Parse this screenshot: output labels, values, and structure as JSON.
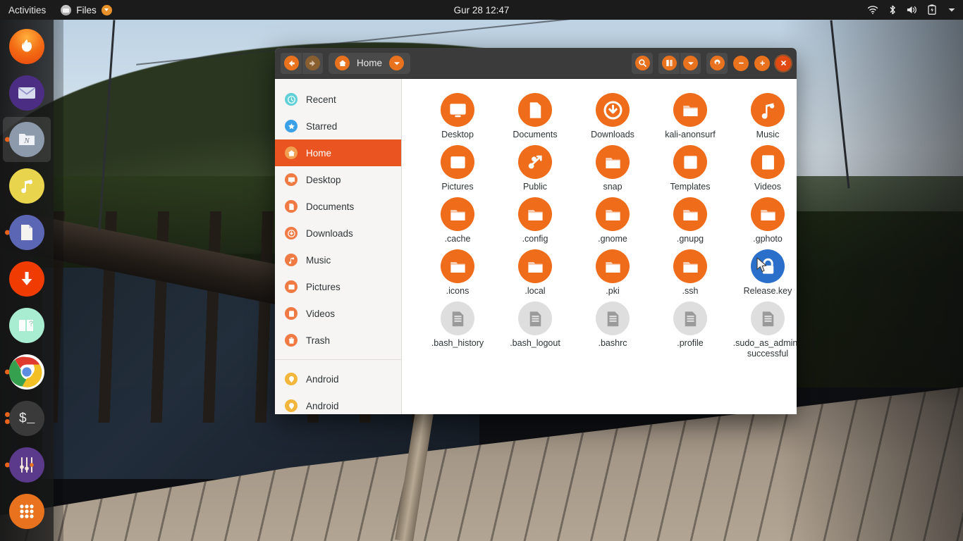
{
  "topbar": {
    "activities": "Activities",
    "app_name": "Files",
    "app_icon": "files-app-icon",
    "clock": "Gur 28  12:47",
    "tray": [
      {
        "name": "wifi-icon",
        "label": "wifi"
      },
      {
        "name": "bluetooth-icon",
        "label": "bluetooth"
      },
      {
        "name": "volume-icon",
        "label": "volume"
      },
      {
        "name": "battery-icon",
        "label": "battery"
      },
      {
        "name": "chevron-down-icon",
        "label": "system menu"
      }
    ]
  },
  "dock": {
    "items": [
      {
        "name": "dock-item-firefox",
        "label": "Firefox",
        "color": "#e8721e",
        "icon": "firefox-icon",
        "running": false,
        "active": false
      },
      {
        "name": "dock-item-thunderbird",
        "label": "Thunderbird Mail",
        "color": "#4b2e83",
        "icon": "mail-icon",
        "running": false,
        "active": false
      },
      {
        "name": "dock-item-files",
        "label": "Files",
        "color": "#8c9aab",
        "icon": "files-icon",
        "running": true,
        "active": true
      },
      {
        "name": "dock-item-rhythmbox",
        "label": "Rhythmbox",
        "color": "#e8d44d",
        "icon": "music-note-icon",
        "running": false,
        "active": false
      },
      {
        "name": "dock-item-libreoffice-writer",
        "label": "LibreOffice Writer",
        "color": "#5b67b5",
        "icon": "document-icon",
        "running": true,
        "active": false
      },
      {
        "name": "dock-item-software-updater",
        "label": "Software Updater",
        "color": "#f03c02",
        "icon": "download-arrow-icon",
        "running": false,
        "active": false
      },
      {
        "name": "dock-item-help",
        "label": "Help",
        "color": "#a8ecd2",
        "icon": "help-book-icon",
        "running": false,
        "active": false
      },
      {
        "name": "dock-item-chrome",
        "label": "Google Chrome",
        "color": "#ffffff",
        "icon": "chrome-icon",
        "running": true,
        "active": false
      },
      {
        "name": "dock-item-terminal",
        "label": "Terminal",
        "color": "#3b3b3b",
        "icon": "terminal-icon",
        "running": true,
        "active": false
      },
      {
        "name": "dock-item-settings",
        "label": "Settings",
        "color": "#5b3a8c",
        "icon": "sliders-icon",
        "running": true,
        "active": false
      },
      {
        "name": "dock-item-show-applications",
        "label": "Show Applications",
        "color": "#e8721e",
        "icon": "grid-dots-icon",
        "running": false,
        "active": false
      }
    ],
    "terminal_prompt": "$_"
  },
  "window": {
    "title": "Home",
    "toolbar": {
      "back": "back-icon",
      "forward": "forward-icon",
      "path_label": "Home",
      "path_dropdown": "chevron-down-icon",
      "search": "search-icon",
      "view_list": "view-list-icon",
      "view_dropdown": "chevron-down-icon",
      "menu": "gear-icon",
      "minimize": "minimize-icon",
      "maximize": "maximize-icon",
      "close": "close-icon"
    },
    "sidebar": [
      {
        "label": "Recent",
        "icon": "clock-icon",
        "color": "#5fcfd8",
        "selected": false
      },
      {
        "label": "Starred",
        "icon": "star-icon",
        "color": "#3aa0e8",
        "selected": false
      },
      {
        "label": "Home",
        "icon": "home-icon",
        "color": "#f0a050",
        "selected": true
      },
      {
        "label": "Desktop",
        "icon": "monitor-icon",
        "color": "#ef7a43",
        "selected": false
      },
      {
        "label": "Documents",
        "icon": "document-icon",
        "color": "#ef7a43",
        "selected": false
      },
      {
        "label": "Downloads",
        "icon": "download-icon",
        "color": "#ef7a43",
        "selected": false
      },
      {
        "label": "Music",
        "icon": "music-icon",
        "color": "#ef7a43",
        "selected": false
      },
      {
        "label": "Pictures",
        "icon": "picture-icon",
        "color": "#ef7a43",
        "selected": false
      },
      {
        "label": "Videos",
        "icon": "video-icon",
        "color": "#ef7a43",
        "selected": false
      },
      {
        "label": "Trash",
        "icon": "trash-icon",
        "color": "#ef7a43",
        "selected": false
      }
    ],
    "sidebar_devices": [
      {
        "label": "Android",
        "icon": "device-icon",
        "color": "#f2b63c"
      },
      {
        "label": "Android",
        "icon": "device-icon",
        "color": "#f2b63c"
      }
    ],
    "files": [
      {
        "label": "Desktop",
        "icon": "monitor-icon",
        "kind": "folder",
        "style": "orange"
      },
      {
        "label": "Documents",
        "icon": "document-icon",
        "kind": "folder",
        "style": "orange"
      },
      {
        "label": "Downloads",
        "icon": "download-icon",
        "kind": "folder",
        "style": "orange"
      },
      {
        "label": "kali-anonsurf",
        "icon": "folder-icon",
        "kind": "folder",
        "style": "orange"
      },
      {
        "label": "Music",
        "icon": "music-icon",
        "kind": "folder",
        "style": "orange"
      },
      {
        "label": "Pictures",
        "icon": "picture-icon",
        "kind": "folder",
        "style": "orange"
      },
      {
        "label": "Public",
        "icon": "share-icon",
        "kind": "folder",
        "style": "orange"
      },
      {
        "label": "snap",
        "icon": "folder-icon",
        "kind": "folder",
        "style": "orange"
      },
      {
        "label": "Templates",
        "icon": "template-icon",
        "kind": "folder",
        "style": "orange"
      },
      {
        "label": "Videos",
        "icon": "video-icon",
        "kind": "folder",
        "style": "orange"
      },
      {
        "label": ".cache",
        "icon": "folder-icon",
        "kind": "folder",
        "style": "orange"
      },
      {
        "label": ".config",
        "icon": "folder-icon",
        "kind": "folder",
        "style": "orange"
      },
      {
        "label": ".gnome",
        "icon": "folder-icon",
        "kind": "folder",
        "style": "orange"
      },
      {
        "label": ".gnupg",
        "icon": "folder-icon",
        "kind": "folder",
        "style": "orange"
      },
      {
        "label": ".gphoto",
        "icon": "folder-icon",
        "kind": "folder",
        "style": "orange"
      },
      {
        "label": ".icons",
        "icon": "folder-icon",
        "kind": "folder",
        "style": "orange"
      },
      {
        "label": ".local",
        "icon": "folder-icon",
        "kind": "folder",
        "style": "orange"
      },
      {
        "label": ".pki",
        "icon": "folder-icon",
        "kind": "folder",
        "style": "orange"
      },
      {
        "label": ".ssh",
        "icon": "folder-icon",
        "kind": "folder",
        "style": "orange"
      },
      {
        "label": "Release.key",
        "icon": "lock-key-icon",
        "kind": "file",
        "style": "blue"
      },
      {
        "label": ".bash_history",
        "icon": "text-file-icon",
        "kind": "file",
        "style": "gray"
      },
      {
        "label": ".bash_logout",
        "icon": "text-file-icon",
        "kind": "file",
        "style": "gray"
      },
      {
        "label": ".bashrc",
        "icon": "text-file-icon",
        "kind": "file",
        "style": "gray"
      },
      {
        "label": ".profile",
        "icon": "text-file-icon",
        "kind": "file",
        "style": "gray"
      },
      {
        "label": ".sudo_as_admin_successful",
        "icon": "text-file-icon",
        "kind": "file",
        "style": "gray"
      }
    ]
  },
  "colors": {
    "ubuntu_orange": "#e95420",
    "icon_orange": "#ef6c1a",
    "headerbar": "#3b3b3b",
    "sidebar_bg": "#f6f5f4",
    "topbar_bg": "#1b1b1b"
  }
}
